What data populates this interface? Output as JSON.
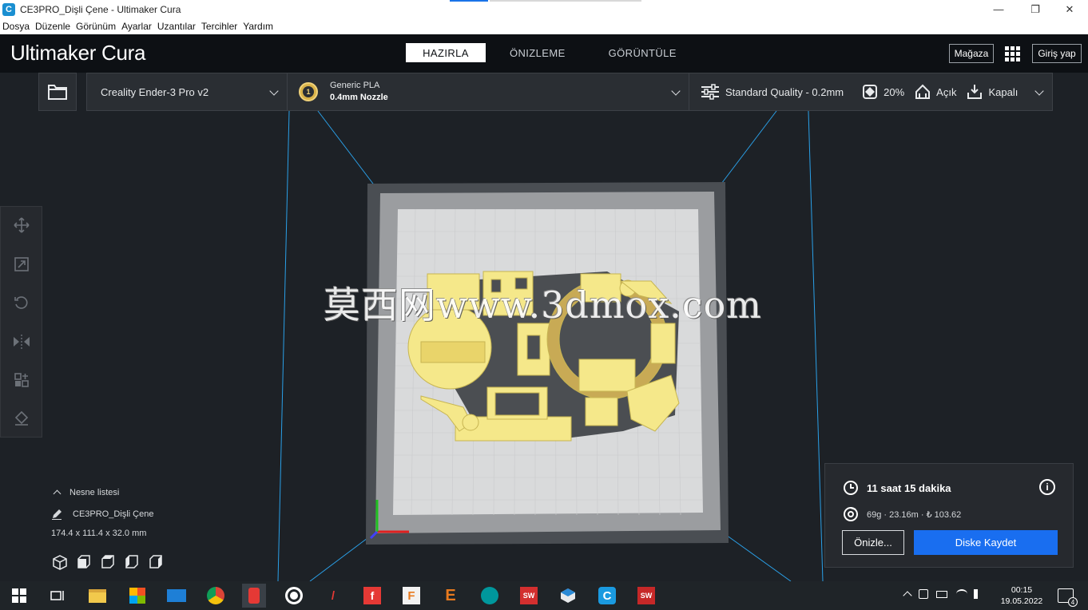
{
  "window": {
    "title": "CE3PRO_Dişli Çene - Ultimaker Cura",
    "controls": [
      "—",
      "❐",
      "✕"
    ]
  },
  "menu": [
    "Dosya",
    "Düzenle",
    "Görünüm",
    "Ayarlar",
    "Uzantılar",
    "Tercihler",
    "Yardım"
  ],
  "header": {
    "logo_bold": "Ultimaker",
    "logo_light": " Cura",
    "tabs": [
      "HAZIRLA",
      "ÖNIZLEME",
      "GÖRÜNTÜLE"
    ],
    "active_tab": "HAZIRLA",
    "store_label": "Mağaza",
    "login_label": "Giriş yap"
  },
  "printer": {
    "name": "Creality Ender-3 Pro v2"
  },
  "material": {
    "extruder": "1",
    "name": "Generic PLA",
    "nozzle": "0.4mm Nozzle"
  },
  "settings": {
    "profile": "Standard Quality - 0.2mm",
    "infill": "20%",
    "support": "Açık",
    "adhesion": "Kapalı"
  },
  "object_list": {
    "toggle_label": "Nesne listesi",
    "object_name": "CE3PRO_Dişli Çene",
    "dimensions": "174.4 x 111.4 x 32.0 mm"
  },
  "print_info": {
    "time": "11 saat 15 dakika",
    "material": "69g · 23.16m · ₺ 103.62",
    "preview_label": "Önizle...",
    "save_label": "Diske Kaydet"
  },
  "watermark": "莫西网www.3dmox.com",
  "taskbar": {
    "time": "00:15",
    "date": "19.05.2022",
    "notifications": "4",
    "apps": [
      "start",
      "task-view",
      "file-explorer",
      "store",
      "mail",
      "chrome",
      "app-red",
      "whatsapp",
      "app-flash",
      "fusion",
      "app-f-orange",
      "app-e-orange",
      "arduino",
      "solidworks-2018",
      "app-cube",
      "cura",
      "solidworks-2018-b"
    ]
  },
  "colors": {
    "accent_blue": "#196ef0",
    "model_yellow": "#f5e88a",
    "header_bg": "#0d1014",
    "viewport_bg": "#1d2126"
  }
}
